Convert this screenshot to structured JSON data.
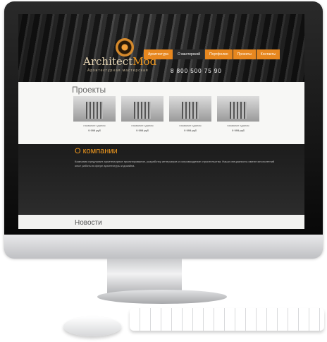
{
  "site": {
    "logo_main": "Architect",
    "logo_accent": "Mod",
    "slogan": "Архитектурная мастерская",
    "phone": "8 800 500 75 90",
    "nav": [
      "Архитектура",
      "О мастерской",
      "Портфолио",
      "Проекты",
      "Контакты"
    ]
  },
  "projects": {
    "title": "Проекты",
    "items": [
      {
        "name": "название здания",
        "price": "9 999 руб"
      },
      {
        "name": "название здания",
        "price": "9 999 руб"
      },
      {
        "name": "название здания",
        "price": "9 999 руб"
      },
      {
        "name": "название здания",
        "price": "9 999 руб"
      }
    ]
  },
  "about": {
    "title": "О компании",
    "text": "Компания предлагает архитектурное проектирование, разработку интерьеров и сопровождение строительства. Наши специалисты имеют многолетний опыт работы в сфере архитектуры и дизайна."
  },
  "news": {
    "title": "Новости"
  },
  "colors": {
    "accent": "#f39a1e",
    "dark": "#1c1c1c"
  }
}
